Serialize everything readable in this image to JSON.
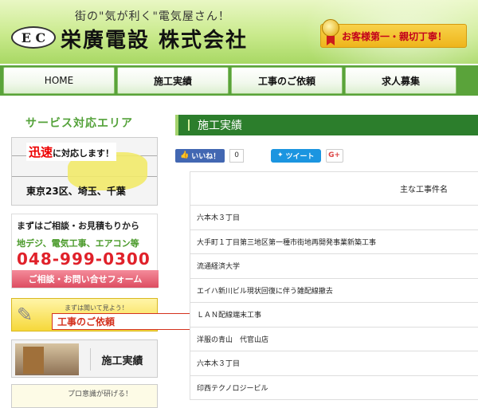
{
  "header": {
    "catchphrase": "街の\"気が利く\"電気屋さん！",
    "logo_text": "E C",
    "company_name": "栄廣電設 株式会社",
    "badge_text": "お客様第一・親切丁寧！"
  },
  "nav": {
    "items": [
      {
        "label": "HOME"
      },
      {
        "label": "施工実績"
      },
      {
        "label": "工事のご依頼"
      },
      {
        "label": "求人募集"
      }
    ]
  },
  "sidebar": {
    "service_area_title": "サービス対応エリア",
    "map_fast": "迅速",
    "map_fast_suffix": "に対応します！",
    "map_region": "東京23区、埼玉、千葉",
    "contact_line1": "まずはご相談・お見積もりから",
    "contact_services": "地デジ、電気工事、エアコン等",
    "contact_phone": "048-999-0300",
    "contact_form_button": "ご相談・お問い合せフォーム",
    "request_small": "まずは聞いて見よう！",
    "request_main": "工事のご依頼",
    "works_label": "施工実績",
    "bottom_banner_text": "プロ意識が研げる！"
  },
  "main": {
    "section_title": "施工実績",
    "fb_like_label": "いいね！",
    "fb_like_count": "0",
    "tweet_label": "ツイート",
    "gplus_label": "G+",
    "table_header": "主な工事件名",
    "rows": [
      "六本木３丁目",
      "大手町１丁目第三地区第一種市街地再開発事業新築工事",
      "流通経済大学",
      "エイハ新川ビル現状回復に伴う雑配線撤去",
      "ＬＡＮ配線端末工事",
      "洋服の青山　代官山店",
      "六本木３丁目",
      "印西テクノロジービル"
    ]
  },
  "colors": {
    "nav_green": "#5aa33a",
    "section_green": "#2c7e2c",
    "phone_red": "#e0212a",
    "accent_yellow": "#f6d83a"
  }
}
